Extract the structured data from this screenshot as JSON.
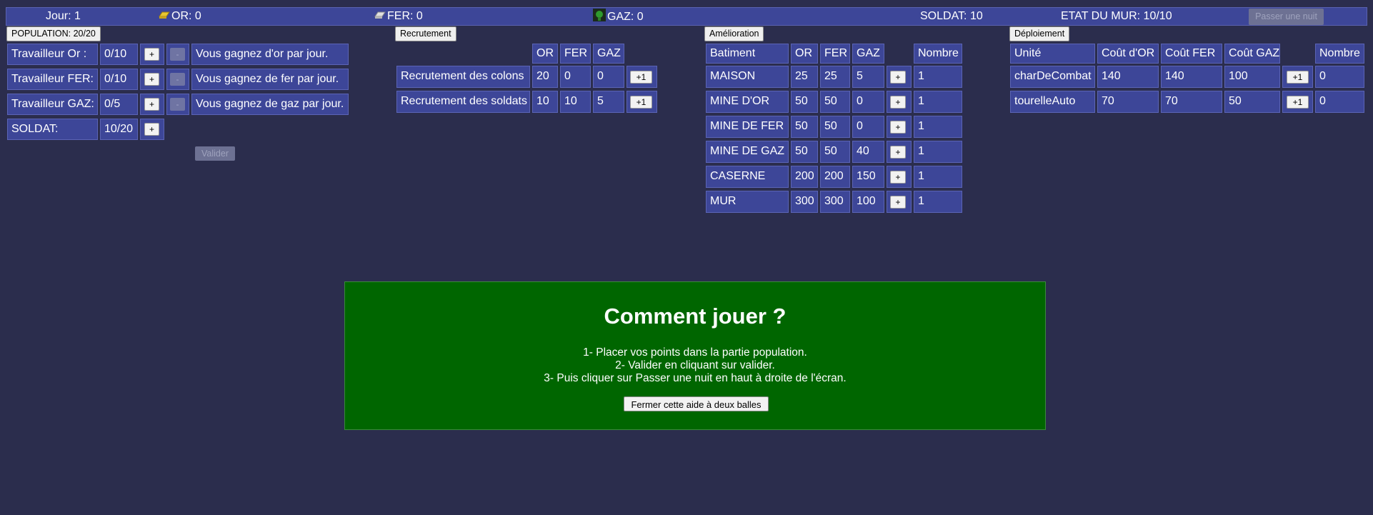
{
  "topbar": {
    "day_label": "Jour: 1",
    "gold": {
      "icon": "gold-bar-icon",
      "text": "OR: 0"
    },
    "iron": {
      "icon": "iron-bar-icon",
      "text": "FER: 0"
    },
    "gas": {
      "icon": "gas-canister-icon",
      "text": "GAZ: 0"
    },
    "soldiers": "SOLDAT: 10",
    "wall": "ETAT DU MUR: 10/10",
    "next_night": "Passer une nuit"
  },
  "population": {
    "title": "POPULATION: 20/20",
    "rows": [
      {
        "label": "Travailleur Or :",
        "value": "0/10",
        "plus": "+",
        "minus": "-",
        "desc": "Vous gagnez d'or par jour."
      },
      {
        "label": "Travailleur FER:",
        "value": "0/10",
        "plus": "+",
        "minus": "-",
        "desc": "Vous gagnez de fer par jour."
      },
      {
        "label": "Travailleur GAZ:",
        "value": "0/5",
        "plus": "+",
        "minus": "-",
        "desc": "Vous gagnez de gaz par jour."
      }
    ],
    "soldier": {
      "label": "SOLDAT:",
      "value": "10/20",
      "plus": "+"
    },
    "validate": "Valider"
  },
  "recruitment": {
    "title": "Recrutement",
    "headers": [
      "OR",
      "FER",
      "GAZ"
    ],
    "rows": [
      {
        "label": "Recrutement des colons",
        "or": "20",
        "fer": "0",
        "gaz": "0",
        "action": "+1"
      },
      {
        "label": "Recrutement des soldats",
        "or": "10",
        "fer": "10",
        "gaz": "5",
        "action": "+1"
      }
    ]
  },
  "upgrade": {
    "title": "Amélioration",
    "headers": [
      "Batiment",
      "OR",
      "FER",
      "GAZ",
      "Nombre"
    ],
    "rows": [
      {
        "name": "MAISON",
        "or": "25",
        "fer": "25",
        "gaz": "5",
        "action": "+",
        "count": "1"
      },
      {
        "name": "MINE D'OR",
        "or": "50",
        "fer": "50",
        "gaz": "0",
        "action": "+",
        "count": "1"
      },
      {
        "name": "MINE DE FER",
        "or": "50",
        "fer": "50",
        "gaz": "0",
        "action": "+",
        "count": "1"
      },
      {
        "name": "MINE DE GAZ",
        "or": "50",
        "fer": "50",
        "gaz": "40",
        "action": "+",
        "count": "1"
      },
      {
        "name": "CASERNE",
        "or": "200",
        "fer": "200",
        "gaz": "150",
        "action": "+",
        "count": "1"
      },
      {
        "name": "MUR",
        "or": "300",
        "fer": "300",
        "gaz": "100",
        "action": "+",
        "count": "1"
      }
    ]
  },
  "deployment": {
    "title": "Déploiement",
    "headers": [
      "Unité",
      "Coût d'OR",
      "Coût FER",
      "Coût GAZ",
      "Nombre"
    ],
    "rows": [
      {
        "name": "charDeCombat",
        "or": "140",
        "fer": "140",
        "gaz": "100",
        "action": "+1",
        "count": "0"
      },
      {
        "name": "tourelleAuto",
        "or": "70",
        "fer": "70",
        "gaz": "50",
        "action": "+1",
        "count": "0"
      }
    ]
  },
  "help": {
    "title": "Comment jouer ?",
    "lines": [
      "1- Placer vos points dans la partie population.",
      "2- Valider en cliquant sur valider.",
      "3- Puis cliquer sur Passer une nuit en haut à droite de l'écran."
    ],
    "close": "Fermer cette aide à deux balles"
  }
}
